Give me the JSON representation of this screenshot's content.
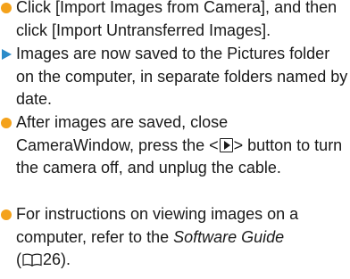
{
  "colors": {
    "bullet": "#f4a21b",
    "arrow": "#2b8bc9",
    "text": "#1a1a1a"
  },
  "items": [
    {
      "marker": "bullet",
      "text": "Click [Import Images from Camera], and then click [Import Untransferred Images]."
    },
    {
      "marker": "arrow",
      "text": "Images are now saved to the Pictures folder on the computer, in separate folders named by date."
    },
    {
      "marker": "bullet",
      "text_before": "After images are saved, close CameraWindow, press the <",
      "button_icon": "playback-button-icon",
      "text_after": "> button to turn the camera off, and unplug the cable."
    },
    {
      "marker": "bullet",
      "text_before": "For instructions on viewing images on a computer, refer to the ",
      "italic": "Software Guide",
      "open_paren": "(",
      "book_icon": "book-reference-icon",
      "page_ref": "26",
      "close_paren": ")."
    }
  ]
}
